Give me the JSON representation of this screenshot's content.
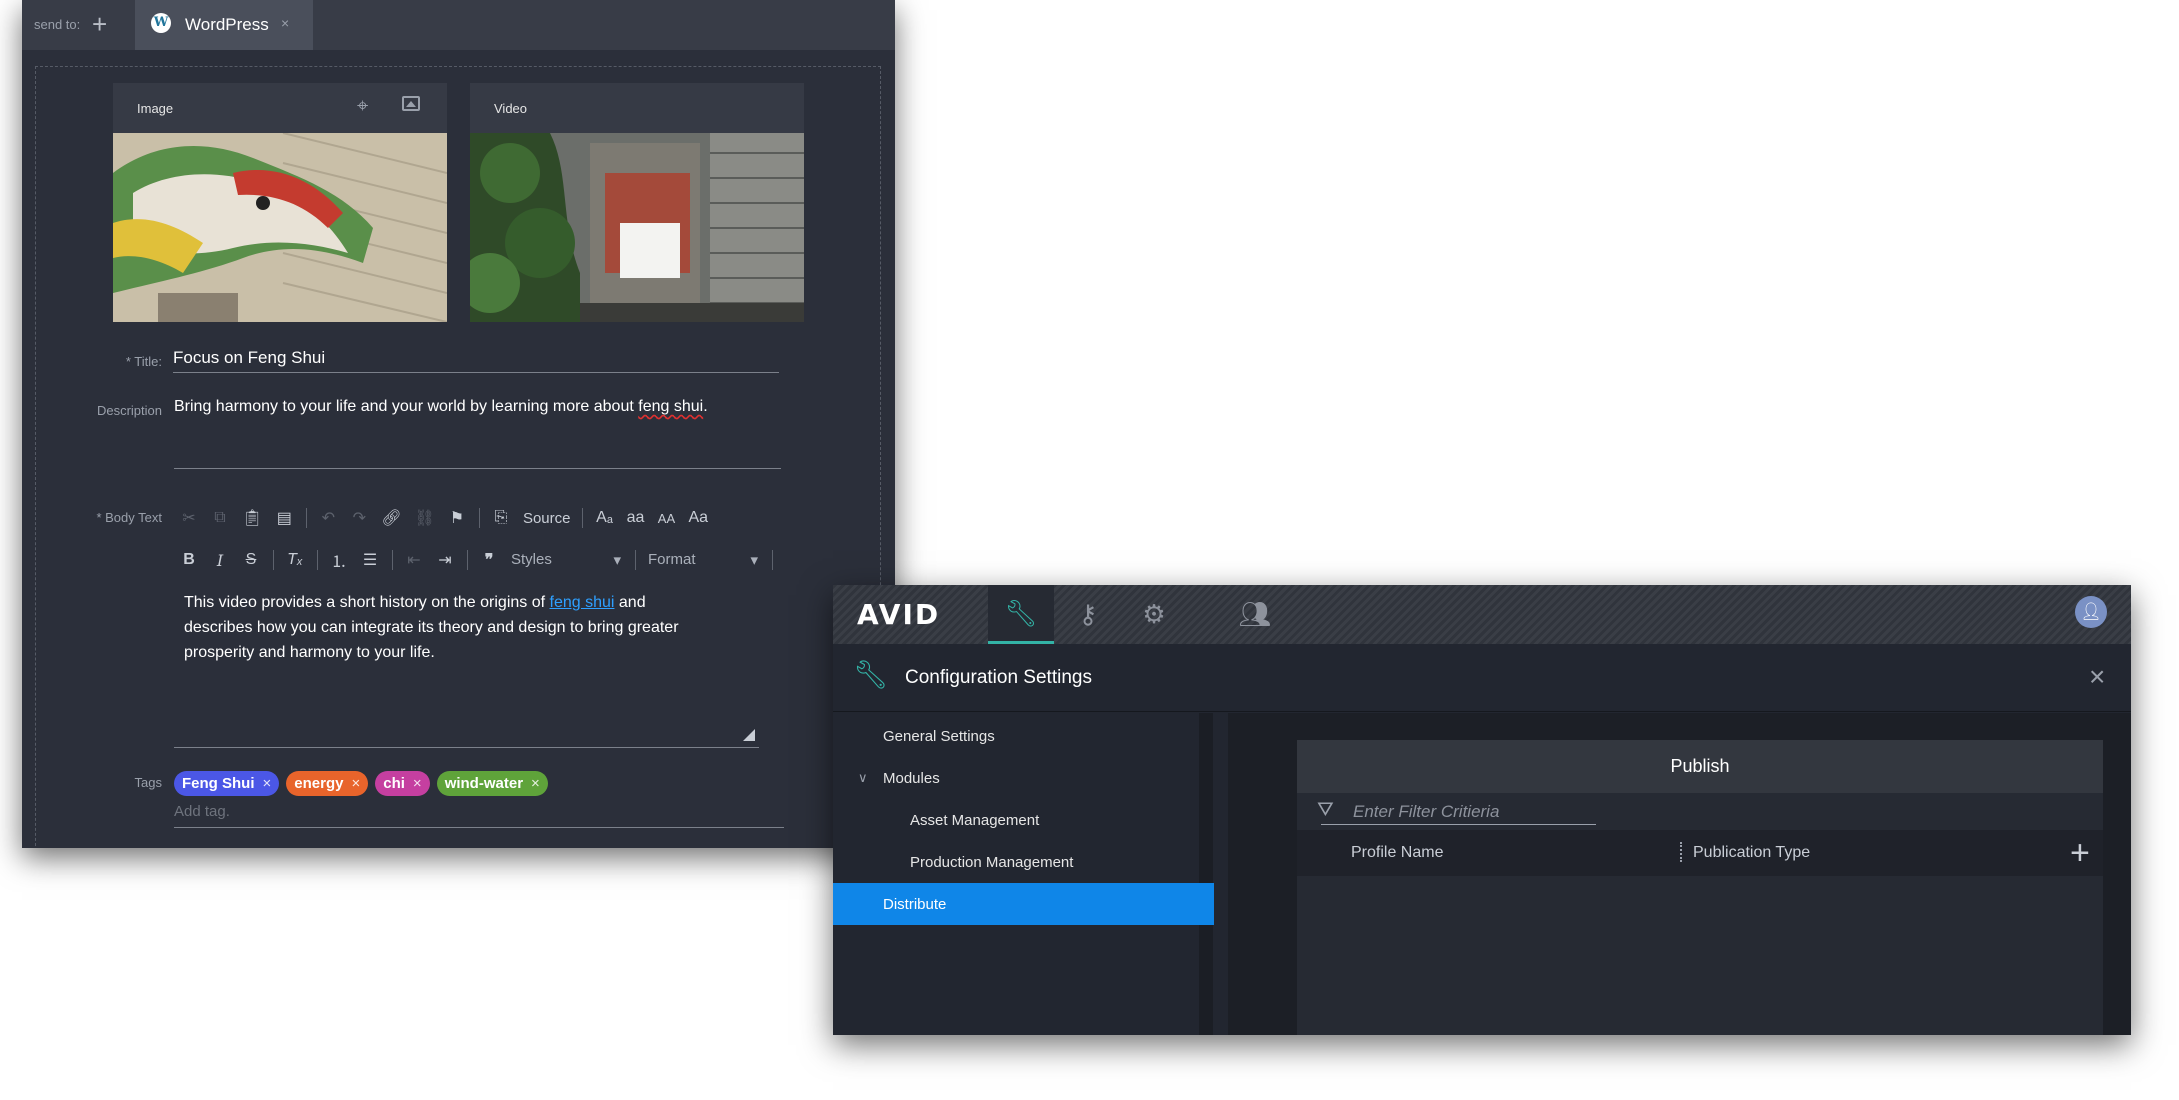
{
  "wordpress": {
    "send_to_label": "send to:",
    "add_icon": "+",
    "tab": {
      "label": "WordPress",
      "close": "×",
      "logo_glyph": "W"
    },
    "image_card": {
      "label": "Image"
    },
    "video_card": {
      "label": "Video"
    },
    "title": {
      "label": "* Title:",
      "value": "Focus on Feng Shui"
    },
    "description": {
      "label": "Description",
      "text_before": "Bring harmony to your life and your world by learning more about ",
      "misspelled": "feng shui",
      "text_after": "."
    },
    "body": {
      "label": "* Body Text",
      "toolbar": {
        "source_label": "Source",
        "styles_label": "Styles",
        "format_label": "Format",
        "case_lower": "aa",
        "case_upper": "AA",
        "case_title": "Aa"
      },
      "text_before": "This video provides a short history on the origins of ",
      "link_text": "feng shui",
      "text_after": " and describes how you can integrate its theory and design to bring greater prosperity and harmony to your life."
    },
    "tags": {
      "label": "Tags",
      "items": [
        {
          "label": "Feng Shui",
          "color": "#4b57e6"
        },
        {
          "label": "energy",
          "color": "#e8642b"
        },
        {
          "label": "chi",
          "color": "#c53fa0"
        },
        {
          "label": "wind-water",
          "color": "#5fa33a"
        }
      ],
      "add_placeholder": "Add tag."
    }
  },
  "avid": {
    "logo": "AVID",
    "header": {
      "title": "Configuration Settings",
      "close": "×"
    },
    "nav": {
      "general": "General Settings",
      "modules": "Modules",
      "asset": "Asset Management",
      "production": "Production Management",
      "distribute": "Distribute"
    },
    "publish": {
      "title": "Publish",
      "filter_placeholder": "Enter Filter Critieria",
      "columns": {
        "profile": "Profile Name",
        "type": "Publication Type"
      },
      "add": "+"
    },
    "accent_color": "#33b3a6",
    "selection_color": "#0f86e8"
  }
}
